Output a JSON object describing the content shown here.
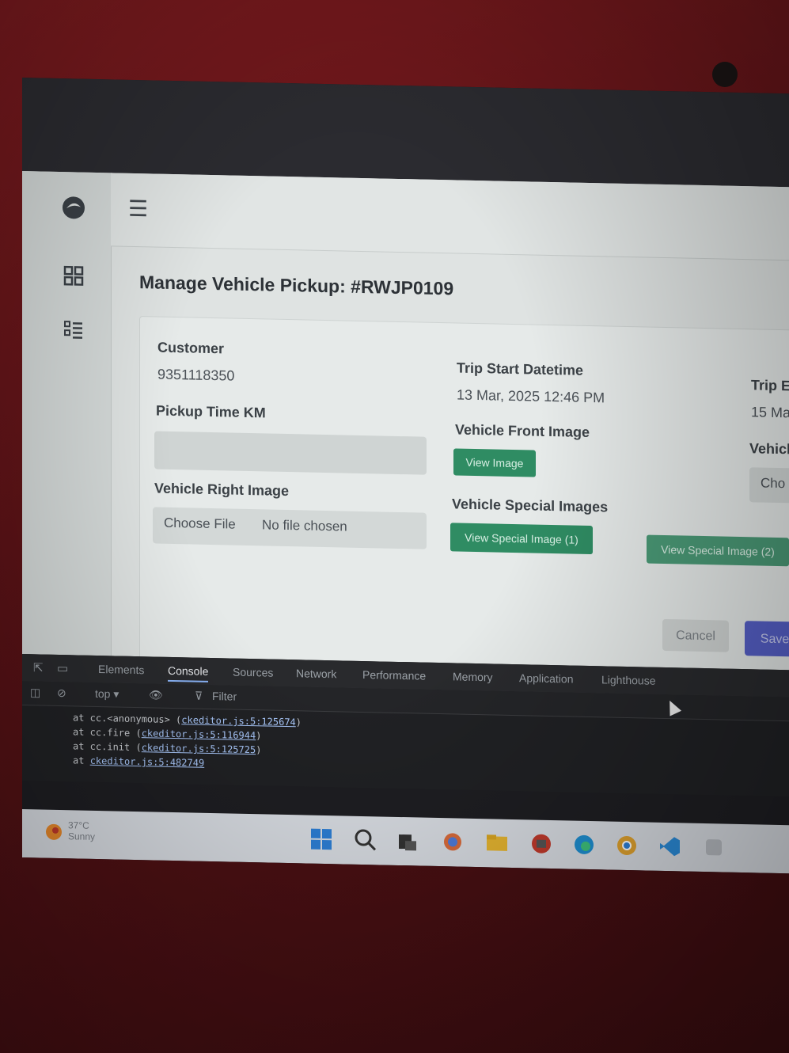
{
  "app": {
    "page_title": "Manage Vehicle Pickup: #RWJP0109"
  },
  "form": {
    "customer_label": "Customer",
    "customer_value": "9351118350",
    "trip_start_label": "Trip Start Datetime",
    "trip_start_value": "13 Mar, 2025 12:46 PM",
    "trip_end_label_partial": "Trip E",
    "trip_end_value_partial": "15 Ma",
    "pickup_km_label": "Pickup Time KM",
    "pickup_km_value": "",
    "vehicle_front_label": "Vehicle Front Image",
    "view_image_button": "View Image",
    "vehicle_third_label_partial": "Vehicl",
    "choose_partial": "Cho",
    "vehicle_right_label": "Vehicle Right Image",
    "choose_file_button": "Choose File",
    "no_file_text": "No file chosen",
    "vehicle_special_label": "Vehicle Special Images",
    "view_special_1": "View Special Image (1)",
    "view_special_2": "View Special Image (2)",
    "cancel_button": "Cancel",
    "save_button": "Save"
  },
  "devtools": {
    "tabs": [
      "Elements",
      "Console",
      "Sources",
      "Network",
      "Performance",
      "Memory",
      "Application",
      "Lighthouse"
    ],
    "active_tab": "Console",
    "context": "top ▾",
    "filter_placeholder": "Filter",
    "console_lines": [
      {
        "prefix": "at cc.<anonymous> (",
        "link": "ckeditor.js:5:125674",
        "suffix": ")"
      },
      {
        "prefix": "at cc.fire (",
        "link": "ckeditor.js:5:116944",
        "suffix": ")"
      },
      {
        "prefix": "at cc.init (",
        "link": "ckeditor.js:5:125725",
        "suffix": ")"
      },
      {
        "prefix": "at ",
        "link": "ckeditor.js:5:482749",
        "suffix": ""
      }
    ]
  },
  "taskbar": {
    "weather_temp": "37°C",
    "weather_desc": "Sunny"
  },
  "colors": {
    "green_button": "#2f8c63",
    "save_button": "#5660c8",
    "bezel": "#7a1a1e"
  }
}
